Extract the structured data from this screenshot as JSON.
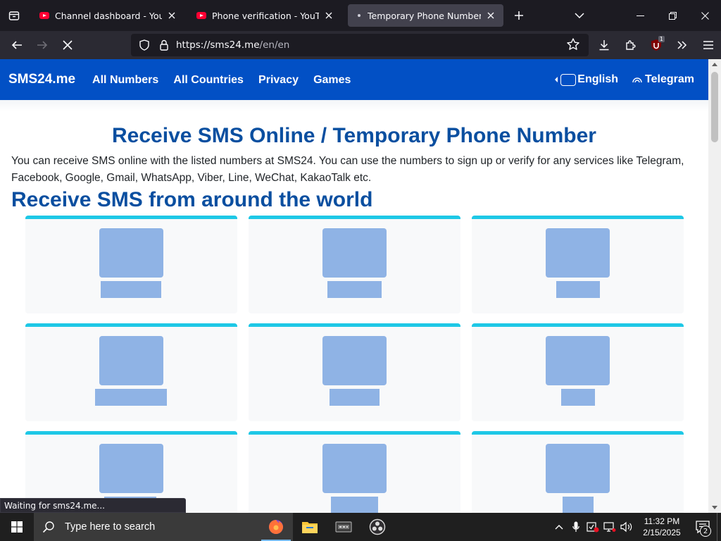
{
  "browser": {
    "tabs": [
      {
        "title": "Channel dashboard - YouTube Studio",
        "icon": "youtube-icon",
        "active": false
      },
      {
        "title": "Phone verification - YouTube",
        "icon": "youtube-icon",
        "active": false
      },
      {
        "title": "Temporary Phone Numbers | Receive SMS",
        "icon": "loading-dot-icon",
        "active": true
      }
    ],
    "url_host": "https://sms24.me",
    "url_path": "/en/en",
    "extension_badge": "1",
    "status_tooltip": "Waiting for sms24.me..."
  },
  "site": {
    "brand": "SMS24.me",
    "nav": {
      "all_numbers": "All Numbers",
      "all_countries": "All Countries",
      "privacy": "Privacy",
      "games": "Games"
    },
    "language": "English",
    "telegram": "Telegram",
    "page_title": "Receive SMS Online / Temporary Phone Number",
    "intro": "You can receive SMS online with the listed numbers at SMS24. You can use the numbers to sign up or verify for any services like Telegram, Facebook, Google, Gmail, WhatsApp, Viber, Line, WeChat, KakaoTalk etc.",
    "section_title": "Receive SMS from around the world"
  },
  "colors": {
    "header_blue": "#0250c5",
    "heading_blue": "#0a4fa0",
    "card_accent": "#1ec8e6",
    "placeholder": "#8fb3e5"
  },
  "taskbar": {
    "search_placeholder": "Type here to search",
    "time": "11:32 PM",
    "date": "2/15/2025",
    "notification_count": "2"
  }
}
